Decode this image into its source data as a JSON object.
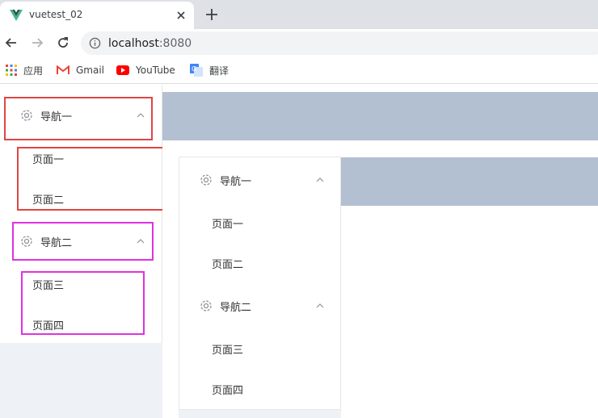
{
  "browser": {
    "tab_title": "vuetest_02",
    "url_host": "localhost",
    "url_port": ":8080",
    "bookmarks": [
      {
        "label": "应用",
        "icon": "apps-grid-icon"
      },
      {
        "label": "Gmail",
        "icon": "gmail-icon"
      },
      {
        "label": "YouTube",
        "icon": "youtube-icon"
      },
      {
        "label": "翻译",
        "icon": "translate-icon"
      }
    ]
  },
  "menu": {
    "groups": [
      {
        "title": "导航一",
        "items": [
          "页面一",
          "页面二"
        ]
      },
      {
        "title": "导航二",
        "items": [
          "页面三",
          "页面四"
        ]
      }
    ]
  },
  "nested_menu": {
    "groups": [
      {
        "title": "导航一",
        "items": [
          "页面一",
          "页面二"
        ]
      },
      {
        "title": "导航二",
        "items": [
          "页面三",
          "页面四"
        ]
      }
    ]
  },
  "colors": {
    "header": "#b3c0d1",
    "aside_bg": "#eef1f6",
    "annotation_red": "#e04545",
    "annotation_magenta": "#e032e0"
  }
}
